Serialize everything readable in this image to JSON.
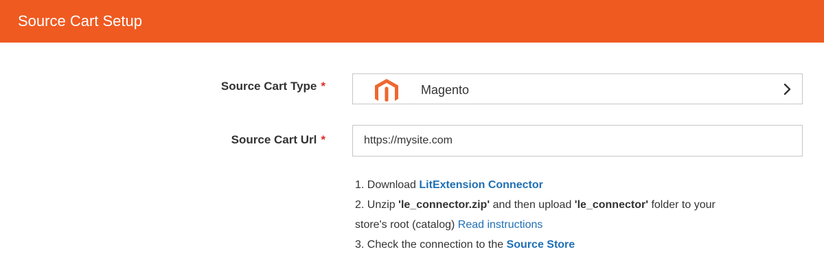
{
  "header": {
    "title": "Source Cart Setup"
  },
  "form": {
    "cart_type": {
      "label": "Source Cart Type",
      "required_mark": "*",
      "selected_value": "Magento",
      "logo_icon": "magento-logo-icon",
      "chevron_icon": "chevron-right-icon"
    },
    "cart_url": {
      "label": "Source Cart Url",
      "required_mark": "*",
      "value": "https://mysite.com"
    }
  },
  "instructions": {
    "step1_prefix": "1. Download ",
    "step1_link": "LitExtension Connector",
    "step2_part1": "2. Unzip ",
    "step2_file": "'le_connector.zip'",
    "step2_part2": " and then upload ",
    "step2_folder": "'le_connector'",
    "step2_part3": " folder to your",
    "step2_line2": "store's root (catalog) ",
    "step2_link": "Read instructions",
    "step3_prefix": "3. Check the connection to the ",
    "step3_link": "Source Store"
  },
  "colors": {
    "header_bg": "#ef5a21",
    "link": "#1f6fb5",
    "required": "#e02b27",
    "magento_orange": "#ee672f"
  }
}
